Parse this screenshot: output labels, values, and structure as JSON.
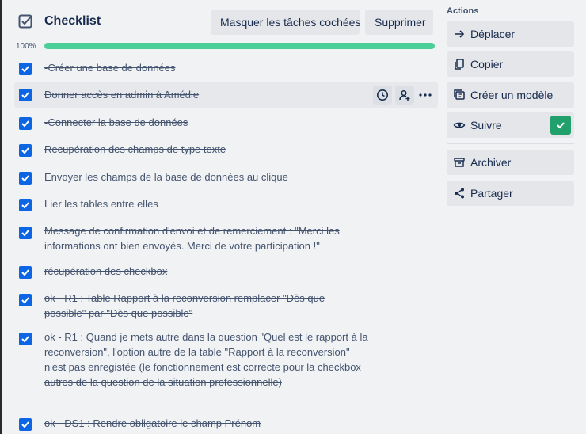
{
  "checklist": {
    "title": "Checklist",
    "hide_checked_label": "Masquer les tâches cochées",
    "delete_label": "Supprimer",
    "progress_label": "100%",
    "progress_fraction": 1.0,
    "accent_color": "#0c66e4",
    "progress_color": "#4bce97",
    "items": [
      {
        "text": "-Créer une base de données",
        "checked": true
      },
      {
        "text": "Donner accès en admin à Amédie",
        "checked": true
      },
      {
        "text": "-Connecter la base de données",
        "checked": true
      },
      {
        "text": "Recupération des champs de type texte",
        "checked": true
      },
      {
        "text": "Envoyer les champs de la base de données au clique",
        "checked": true
      },
      {
        "text": "Lier les tables entre elles",
        "checked": true
      },
      {
        "text": "Message de confirmation d'envoi et de remerciement : \"Merci les informations ont bien envoyés. Merci de votre participation !\"",
        "checked": true
      },
      {
        "text": "récupération des checkbox",
        "checked": true
      },
      {
        "text": "ok - R1 : Table Rapport à la reconversion remplacer \"Dès que possible\" par \"Dès que possible\"",
        "checked": true
      },
      {
        "text": "ok - R1 : Quand je mets autre dans la question \"Quel est le rapport à la reconversion\", l'option autre de la table \"Rapport à la reconversion\" n'est pas enregistée (le fonctionnement est correcte pour la checkbox autres de la question de la situation professionnelle)",
        "checked": true
      },
      {
        "text": "ok - DS1 : Rendre obligatoire le champ Prénom",
        "checked": true
      }
    ],
    "hover_item_actions": [
      "clock-icon",
      "assign-member-icon",
      "more-icon"
    ]
  },
  "sidebar": {
    "heading": "Actions",
    "buttons": [
      {
        "label": "Déplacer",
        "icon": "arrow-right-icon"
      },
      {
        "label": "Copier",
        "icon": "copy-icon"
      },
      {
        "label": "Créer un modèle",
        "icon": "template-icon"
      },
      {
        "label": "Suivre",
        "icon": "eye-icon",
        "active": true,
        "active_color": "#22a06b"
      },
      {
        "label": "Archiver",
        "icon": "archive-icon"
      },
      {
        "label": "Partager",
        "icon": "share-icon"
      }
    ]
  }
}
